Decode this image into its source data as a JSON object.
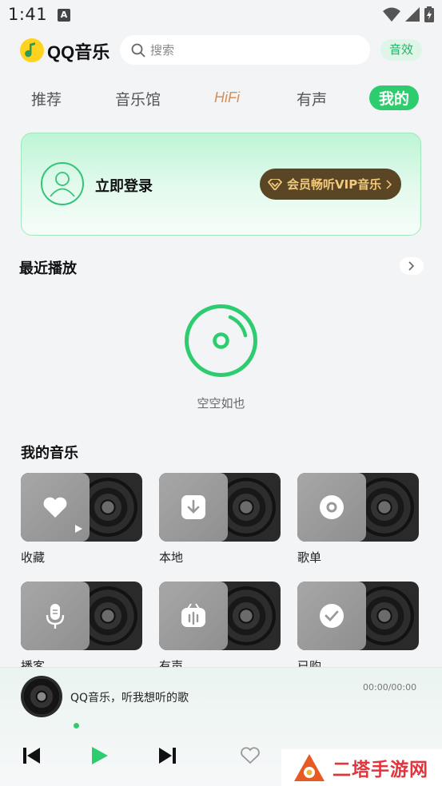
{
  "status_bar": {
    "time": "1:41",
    "notification_letter": "A"
  },
  "header": {
    "app_name": "QQ音乐",
    "search_placeholder": "搜索",
    "effect_button": "音效"
  },
  "tabs": [
    {
      "label": "推荐"
    },
    {
      "label": "音乐馆"
    },
    {
      "label": "HiFi"
    },
    {
      "label": "有声"
    },
    {
      "label": "我的",
      "active": true
    }
  ],
  "login_card": {
    "login_label": "立即登录",
    "vip_button": "会员畅听VIP音乐"
  },
  "recent": {
    "title": "最近播放",
    "empty_text": "空空如也"
  },
  "my_music": {
    "title": "我的音乐",
    "items": [
      {
        "label": "收藏",
        "icon": "heart-icon"
      },
      {
        "label": "本地",
        "icon": "download-icon"
      },
      {
        "label": "歌单",
        "icon": "disc-icon"
      },
      {
        "label": "播客",
        "icon": "microphone-icon"
      },
      {
        "label": "有声",
        "icon": "audiobook-icon"
      },
      {
        "label": "已购",
        "icon": "check-icon"
      }
    ]
  },
  "player": {
    "song_title": "QQ音乐，听我想听的歌",
    "time": "00:00/00:00"
  },
  "watermark": {
    "text": "二塔手游网"
  },
  "colors": {
    "accent": "#2dcc6f",
    "vip_bg": "#5a4625",
    "vip_text": "#f3c97b",
    "hifi": "#d4905a"
  }
}
